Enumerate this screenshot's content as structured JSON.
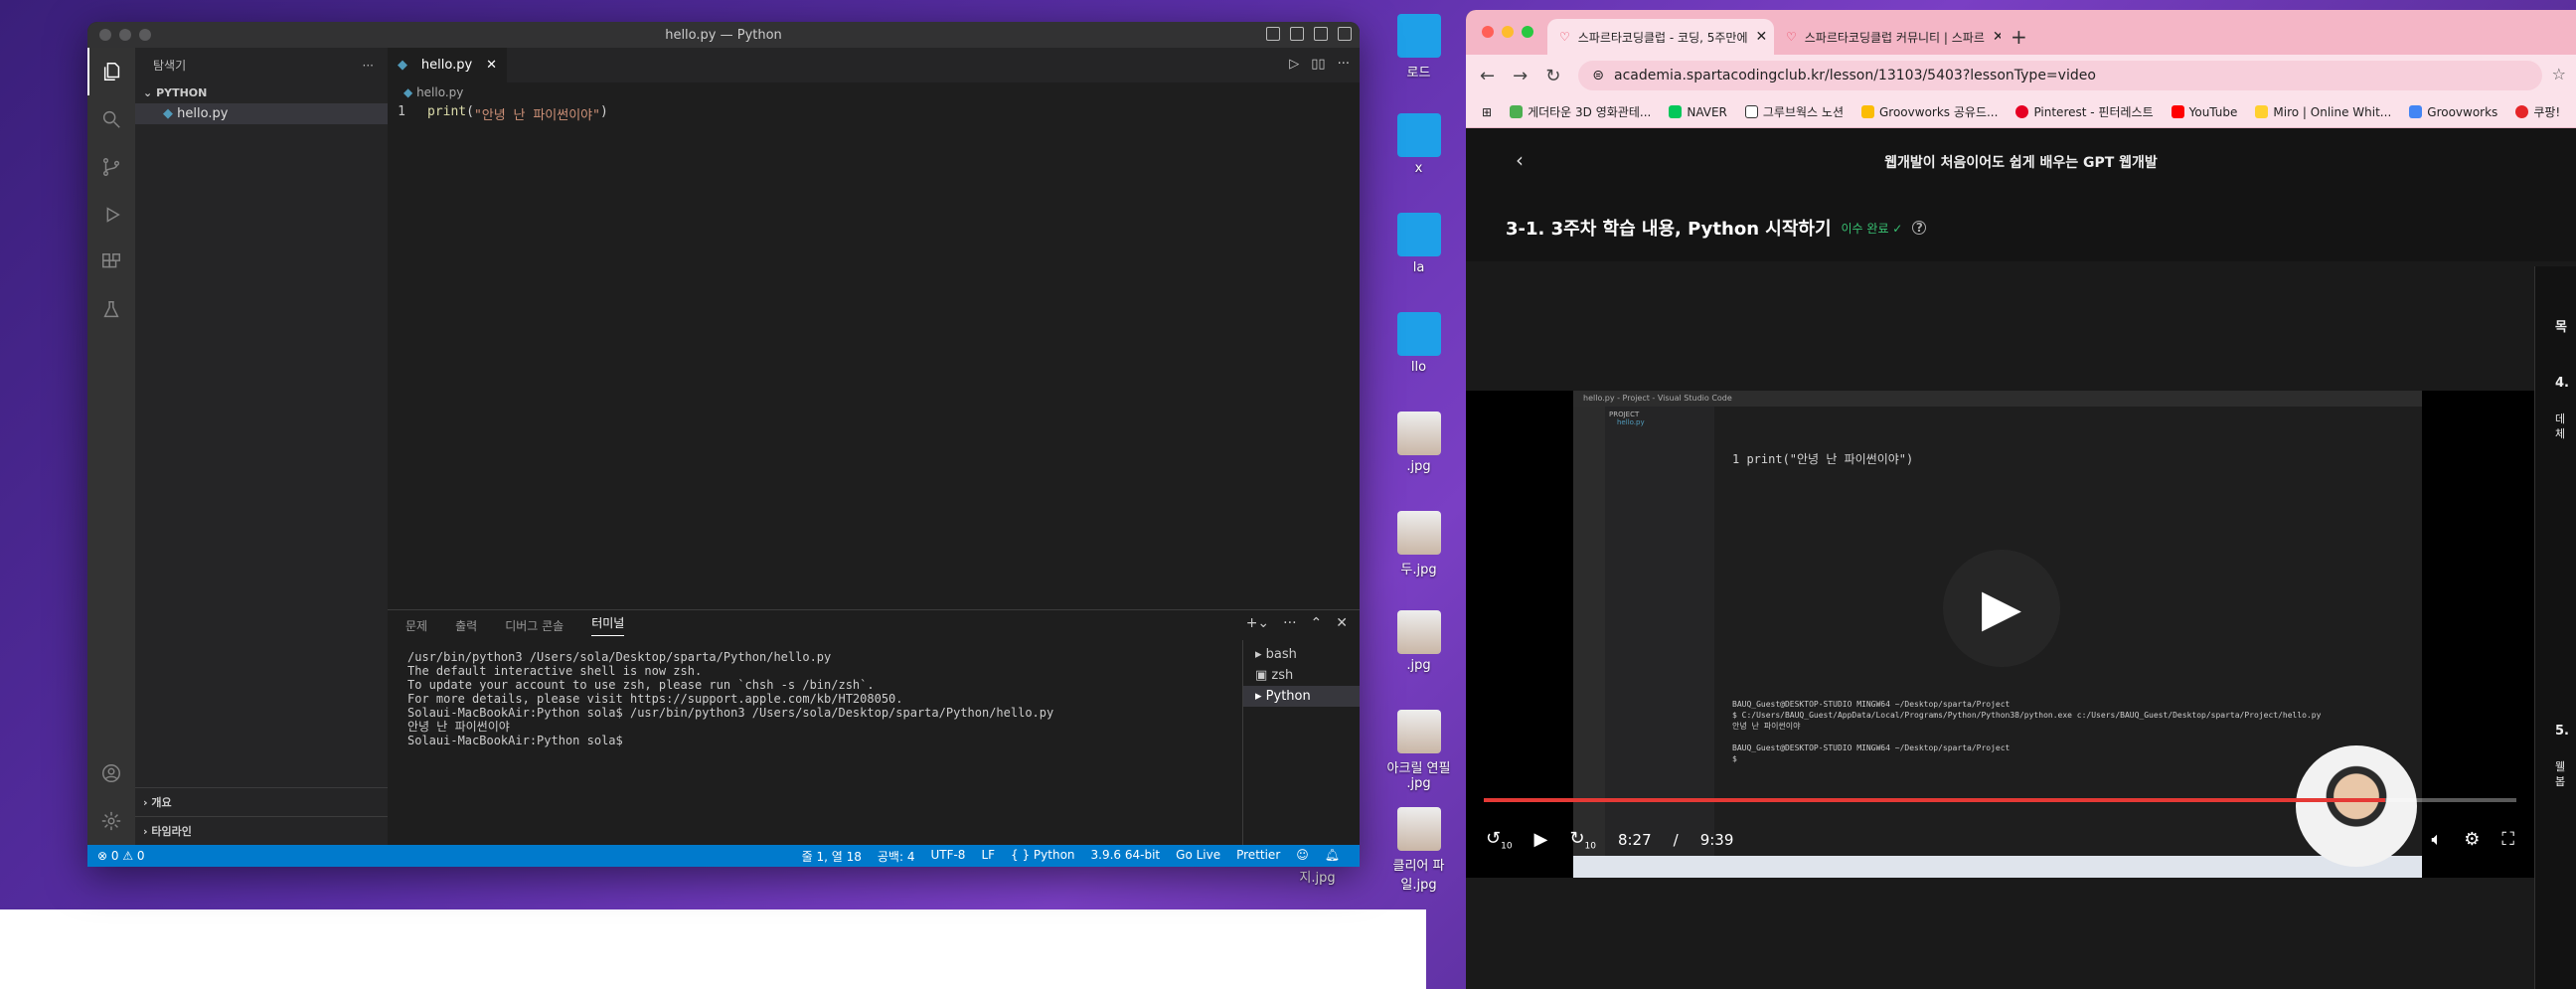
{
  "desktop": {
    "labels": [
      "로드",
      "x",
      "la",
      "llo",
      ".jpg",
      "두.jpg",
      ".jpg",
      "아크릴 연필",
      ".jpg",
      "클리어 파",
      "일.jpg",
      "지.jpg"
    ]
  },
  "vscode": {
    "window_title": "hello.py — Python",
    "explorer_title": "탐색기",
    "explorer_more": "···",
    "folder": "PYTHON",
    "file": "hello.py",
    "outline": "개요",
    "timeline": "타임라인",
    "tab": "hello.py",
    "tab_close": "✕",
    "breadcrumb": "hello.py",
    "code": {
      "line_no": "1",
      "fn": "print",
      "open": "(",
      "string": "\"안녕 난 파이썬이야\"",
      "close": ")"
    },
    "panel_tabs": [
      "문제",
      "출력",
      "디버그 콘솔",
      "터미널"
    ],
    "terminal_lines": [
      "/usr/bin/python3 /Users/sola/Desktop/sparta/Python/hello.py",
      "",
      "The default interactive shell is now zsh.",
      "To update your account to use zsh, please run `chsh -s /bin/zsh`.",
      "For more details, please visit https://support.apple.com/kb/HT208050.",
      "Solaui-MacBookAir:Python sola$ /usr/bin/python3 /Users/sola/Desktop/sparta/Python/hello.py",
      "안녕 난 파이썬이야",
      "Solaui-MacBookAir:Python sola$"
    ],
    "terminals": [
      "bash",
      "zsh",
      "Python"
    ],
    "status_left": "⊗ 0 ⚠ 0",
    "status_right": [
      "줄 1, 열 18",
      "공백: 4",
      "UTF-8",
      "LF",
      "{ } Python",
      "3.9.6 64-bit",
      "Go Live",
      "Prettier"
    ]
  },
  "chrome": {
    "tabs": [
      {
        "title": "스파르타코딩클럽 - 코딩, 5주만에",
        "close": "✕"
      },
      {
        "title": "스파르타코딩클럽 커뮤니티 | 스파르",
        "close": "✕"
      }
    ],
    "new_tab": "+",
    "url": "academia.spartacodingclub.kr/lesson/13103/5403?lessonType=video",
    "bookmarks": [
      "게더타운 3D 영화관테...",
      "NAVER",
      "그루브웍스 노션",
      "Groovworks 공유드...",
      "Pinterest - 핀터레스트",
      "YouTube",
      "Miro | Online Whit...",
      "Groovworks",
      "쿠팡!"
    ],
    "course_title": "웹개발이 처음이어도 쉽게 배우는 GPT 웹개발",
    "lesson_title": "3-1. 3주차 학습 내용, Python 시작하기",
    "lesson_status": "이수 완료 ✓",
    "info_icon": "?",
    "back_icon": "‹",
    "side_labels": [
      "목",
      "4.",
      "데",
      "체",
      "5.",
      "웰",
      "봅"
    ]
  },
  "video": {
    "inner_title": "hello.py - Project - Visual Studio Code",
    "inner_project": "PROJECT",
    "inner_file": "hello.py",
    "inner_code": "1    print(\"안녕 난 파이썬이야\")",
    "inner_terminal": "BAUQ_Guest@DESKTOP-STUDIO MINGW64 ~/Desktop/sparta/Project\n$ C:/Users/BAUQ_Guest/AppData/Local/Programs/Python/Python38/python.exe c:/Users/BAUQ_Guest/Desktop/sparta/Project/hello.py\n안녕 난 파이썬이야\n\nBAUQ_Guest@DESKTOP-STUDIO MINGW64 ~/Desktop/sparta/Project\n$",
    "current_time": "8:27",
    "separator": "/",
    "total_time": "9:39",
    "progress": 0.873,
    "rewind": "10",
    "forward": "10"
  }
}
